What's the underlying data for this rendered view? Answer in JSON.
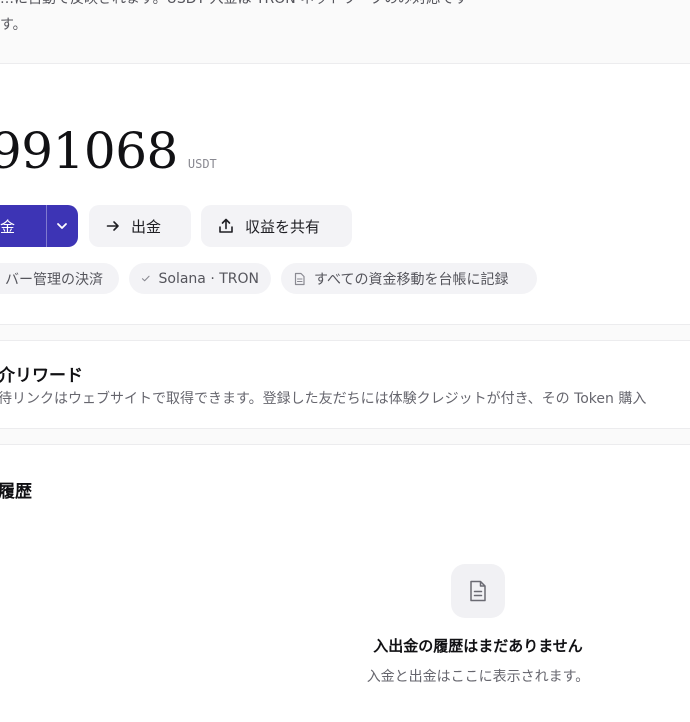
{
  "notice": {
    "line1": "…に自動で反映されます。USDT 入金は TRON ネットワークのみ対応です",
    "line2": "す。"
  },
  "balance": {
    "value": "991068",
    "unit": "USDT"
  },
  "actions": {
    "deposit_label": "金",
    "withdraw_label": "出金",
    "share_label": "収益を共有"
  },
  "chips": {
    "custody": "バー管理の決済",
    "network": "Solana · TRON",
    "ledger": "すべての資金移動を台帳に記録"
  },
  "referral": {
    "title": "介リワード",
    "description": "待リンクはウェブサイトで取得できます。登録した友だちには体験クレジットが付き、その Token 購入"
  },
  "history": {
    "title": "履歴",
    "empty_title": "入出金の履歴はまだありません",
    "empty_subtitle": "入金と出金はここに表示されます。"
  },
  "icons": {
    "dropdown": "chevron-down-icon",
    "withdraw": "arrow-right-icon",
    "share": "share-upload-icon",
    "check": "check-icon",
    "document": "document-icon"
  },
  "colors": {
    "accent": "#3d34b5",
    "surface": "#f3f3f6",
    "text": "#1f1f24",
    "muted": "#66666e"
  }
}
